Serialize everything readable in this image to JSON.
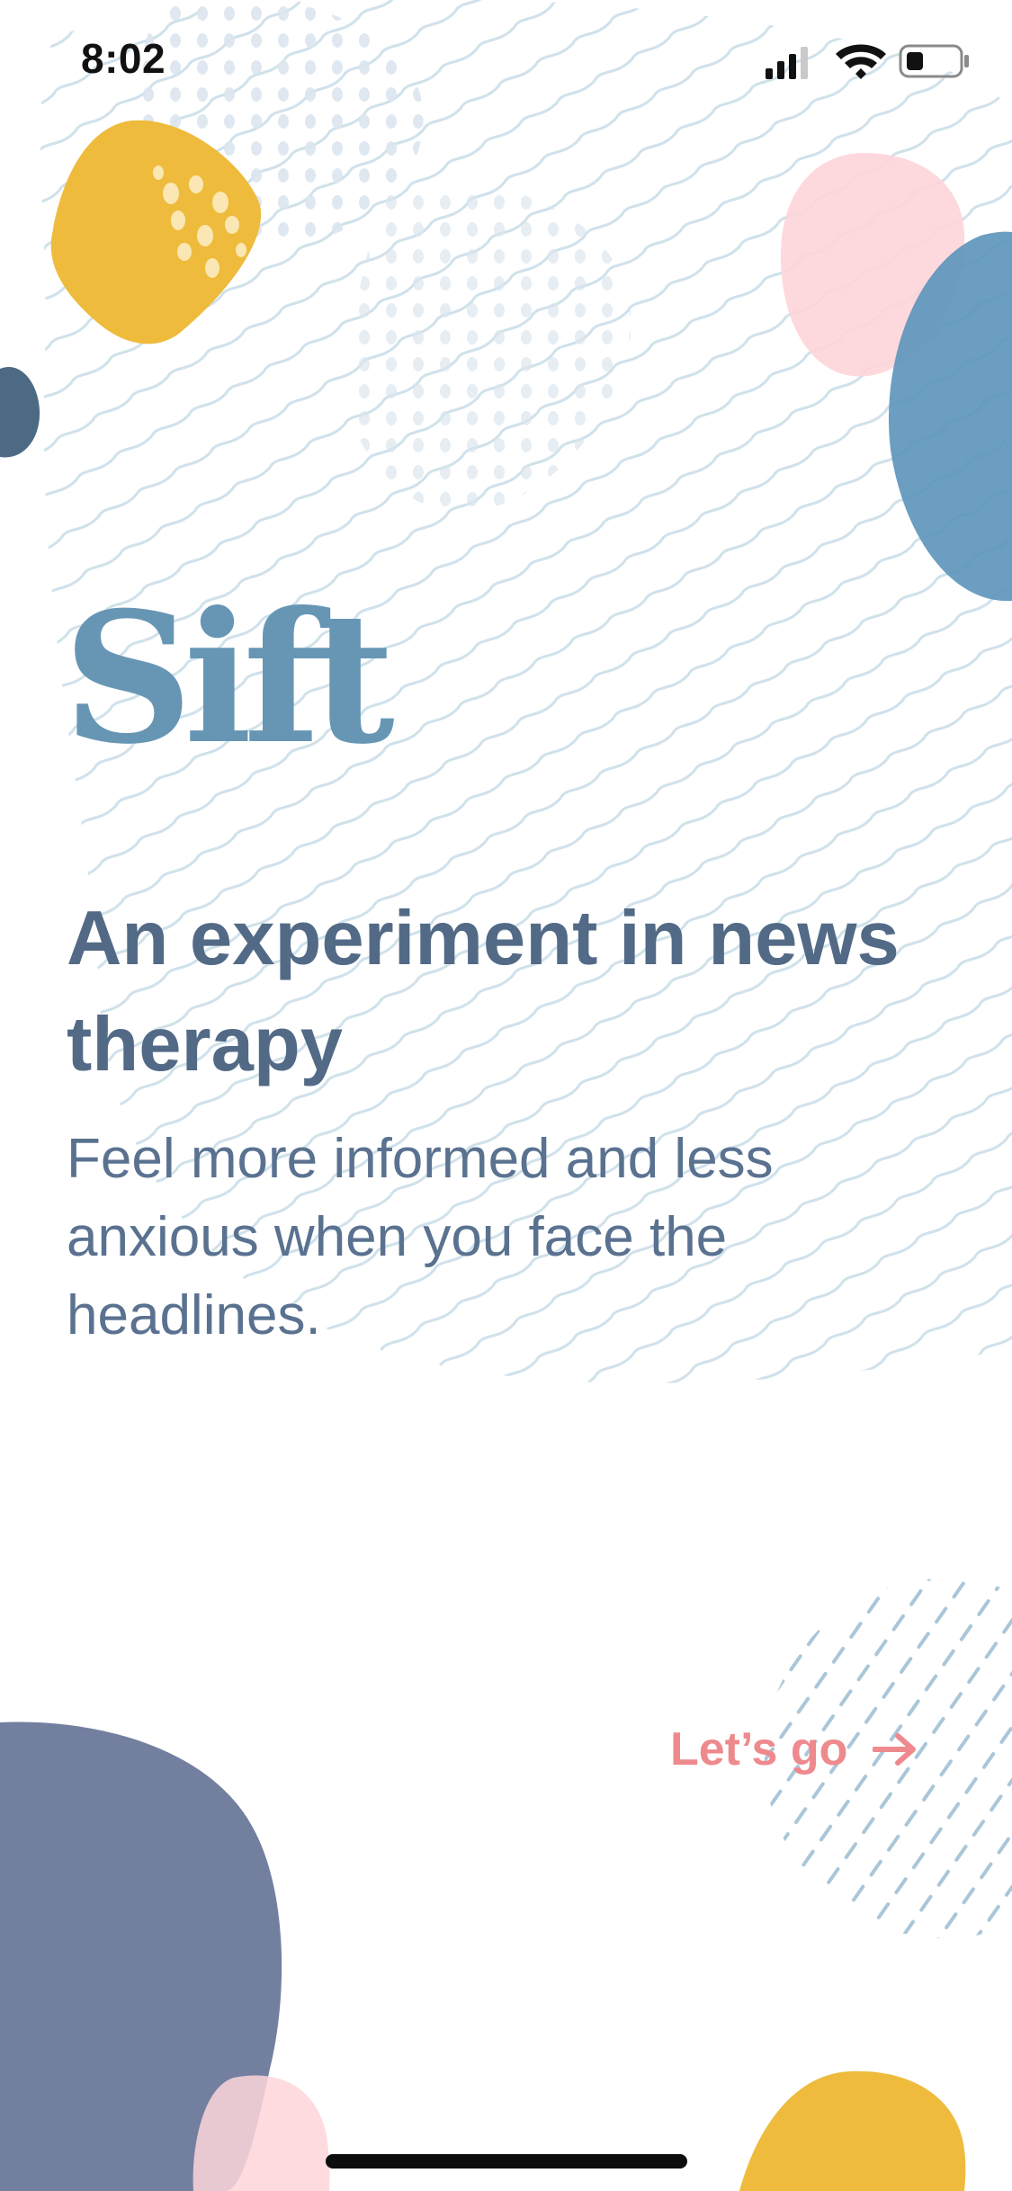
{
  "status_bar": {
    "time": "8:02",
    "icons": [
      "cellular-signal-icon",
      "wifi-icon",
      "battery-icon"
    ]
  },
  "brand": {
    "name": "Sift"
  },
  "hero": {
    "headline": "An experiment in news therapy",
    "subhead": "Feel more informed and less anxious when you face the headlines."
  },
  "cta": {
    "label": "Let’s go",
    "icon": "arrow-right-icon"
  },
  "colors": {
    "brand_blue": "#6796b5",
    "headline": "#526a86",
    "cta_coral": "#ee8a8e",
    "mustard": "#eebb3c",
    "pink": "#fdd5d9",
    "slate_purple": "#737f9f",
    "steel_blue": "#5e96bc"
  }
}
